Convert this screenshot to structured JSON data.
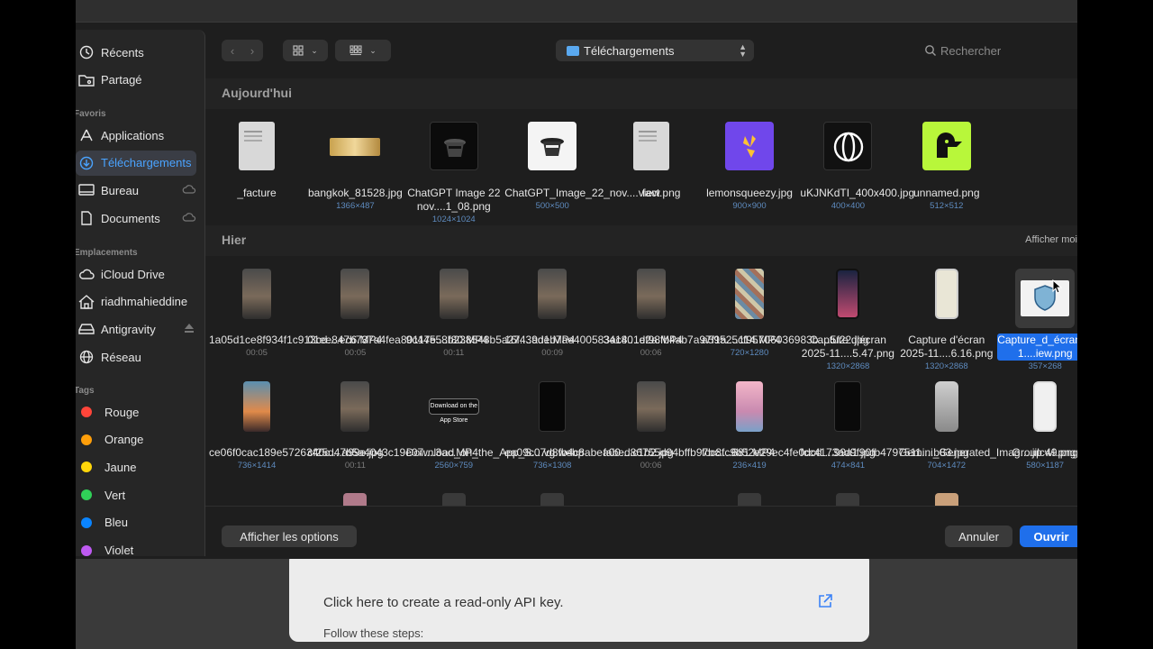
{
  "background": {
    "card_link": "Click here to create a read-only API key.",
    "card_steps": "Follow these steps:"
  },
  "sidebar": {
    "top_items": [
      {
        "label": "Récents",
        "icon": "clock-icon"
      },
      {
        "label": "Partagé",
        "icon": "shared-folder-icon"
      }
    ],
    "favorites_title": "Favoris",
    "favorites": [
      {
        "label": "Applications",
        "icon": "applications-icon"
      },
      {
        "label": "Téléchargements",
        "icon": "download-icon",
        "selected": true
      },
      {
        "label": "Bureau",
        "icon": "desktop-icon",
        "cloud": true
      },
      {
        "label": "Documents",
        "icon": "document-icon",
        "cloud": true
      }
    ],
    "locations_title": "Emplacements",
    "locations": [
      {
        "label": "iCloud Drive",
        "icon": "cloud-icon"
      },
      {
        "label": "riadhmahieddine",
        "icon": "home-icon"
      },
      {
        "label": "Antigravity",
        "icon": "drive-icon",
        "eject": true
      },
      {
        "label": "Réseau",
        "icon": "globe-icon"
      }
    ],
    "tags_title": "Tags",
    "tags": [
      {
        "label": "Rouge",
        "color": "#ff453a"
      },
      {
        "label": "Orange",
        "color": "#ff9f0a"
      },
      {
        "label": "Jaune",
        "color": "#ffd60a"
      },
      {
        "label": "Vert",
        "color": "#30d158"
      },
      {
        "label": "Bleu",
        "color": "#0a84ff"
      },
      {
        "label": "Violet",
        "color": "#bf5af2"
      }
    ]
  },
  "toolbar": {
    "location": "Téléchargements",
    "search_placeholder": "Rechercher"
  },
  "groups": {
    "today_title": "Aujourd'hui",
    "yesterday_title": "Hier",
    "show_less": "Afficher moi"
  },
  "files_today": [
    {
      "name": "_facture",
      "meta": "",
      "kind": "doc"
    },
    {
      "name": "bangkok_81528.jpg",
      "meta": "1366×487",
      "kind": "landscape"
    },
    {
      "name": "ChatGPT Image 22 nov....1_08.png",
      "meta": "1024×1024",
      "kind": "dark-spy"
    },
    {
      "name": "ChatGPT_Image_22_nov....view.png",
      "meta": "500×500",
      "kind": "light-spy"
    },
    {
      "name": "fact",
      "meta": "",
      "kind": "doc"
    },
    {
      "name": "lemonsqueezy.jpg",
      "meta": "900×900",
      "kind": "lemon"
    },
    {
      "name": "uKJNKdTI_400x400.jpg",
      "meta": "400×400",
      "kind": "globe"
    },
    {
      "name": "unnamed.png",
      "meta": "512×512",
      "kind": "bird"
    }
  ],
  "files_yesterday_row1": [
    {
      "name": "1a05d1ce8f934f1c913cd....ec6.MP4",
      "meta": "00:05",
      "kind": "video",
      "dur": true
    },
    {
      "name": "01ee847b737a4fea80117e....f80.MP4",
      "meta": "00:05",
      "kind": "video",
      "dur": true
    },
    {
      "name": "9c44558b238548b5a27....ade.MP4",
      "meta": "00:11",
      "kind": "video",
      "dur": true
    },
    {
      "name": "16f439d1b7ae400583ac4....d2a.MP4",
      "meta": "00:09",
      "kind": "video",
      "dur": true
    },
    {
      "name": "341801ef98fb4ab7a97f1a....114.MP4",
      "meta": "00:06",
      "kind": "video",
      "dur": true
    },
    {
      "name": "a59525cf95706036983b....5f22.jpg",
      "meta": "720×1280",
      "kind": "collage"
    },
    {
      "name": "Capture d'écran 2025-11....5.47.png",
      "meta": "1320×2868",
      "kind": "phone-dark"
    },
    {
      "name": "Capture d'écran 2025-11....6.16.png",
      "meta": "1320×2868",
      "kind": "phone-light"
    },
    {
      "name": "Capture_d_écran_2025-1....iew.png",
      "meta": "357×268",
      "kind": "shield",
      "selected": true
    }
  ],
  "files_yesterday_row2": [
    {
      "name": "ce06f0cac189e5726340c....a99e.jpg",
      "meta": "736×1414",
      "kind": "sunset"
    },
    {
      "name": "cf25d47b5a4043c19e07....3ac.MP4",
      "meta": "00:11",
      "kind": "video",
      "dur": true
    },
    {
      "name": "Download_on_the_App_S....vg.webp",
      "meta": "2560×759",
      "kind": "appstore",
      "badge": "Download on the App Store"
    },
    {
      "name": "ea09c07d8fb4c8abea00....c1b2.jpg",
      "meta": "736×1308",
      "kind": "black"
    },
    {
      "name": "fabed86755d94bffb97bc....681.MP4",
      "meta": "00:06",
      "kind": "video",
      "dur": true
    },
    {
      "name": "fcc8fc9b52e29ec4fe0dcd....99a1.jpg",
      "meta": "236×419",
      "kind": "pink"
    },
    {
      "name": "fcc4173ad9f90fb4797511....b83.jpg",
      "meta": "474×841",
      "kind": "black2"
    },
    {
      "name": "Gemini_Generated_Imag....jilcwl.png",
      "meta": "704×1472",
      "kind": "phone-gray"
    },
    {
      "name": "Group 49.png",
      "meta": "580×1187",
      "kind": "phone-white"
    }
  ],
  "bottom": {
    "options": "Afficher les options",
    "cancel": "Annuler",
    "open": "Ouvrir"
  }
}
